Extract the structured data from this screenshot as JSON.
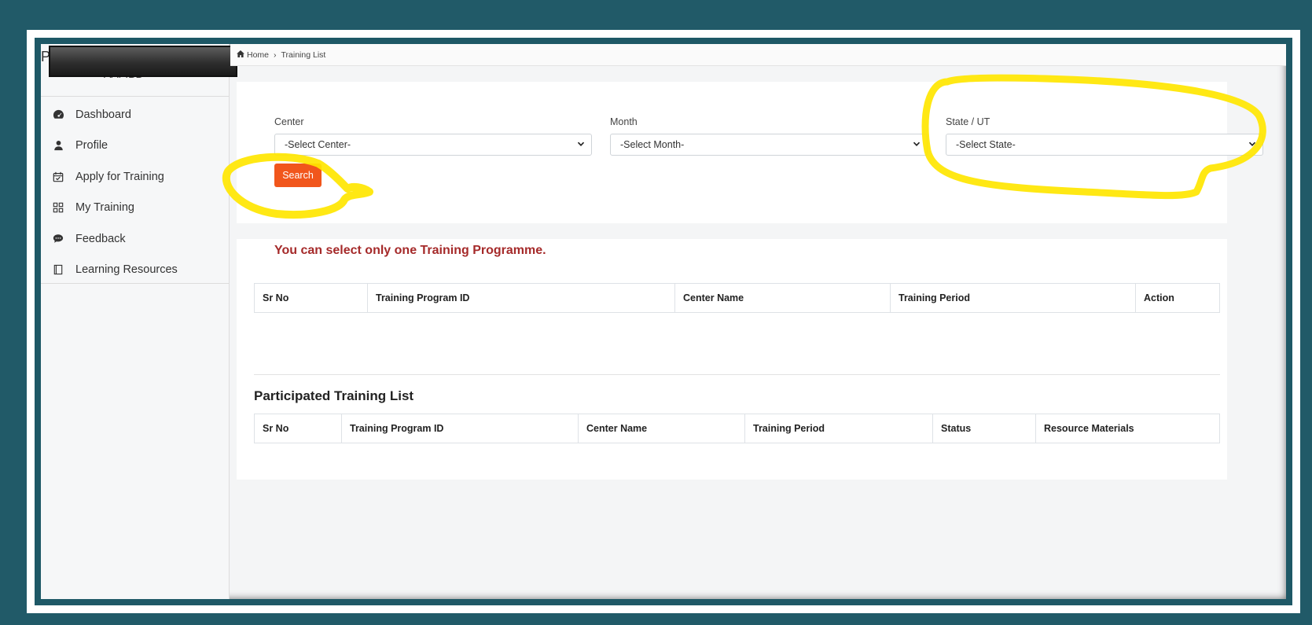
{
  "sidebar": {
    "brand_letter": "P",
    "brand_sub": "AAFIBD",
    "items": [
      {
        "label": "Dashboard",
        "icon": "dashboard-icon"
      },
      {
        "label": "Profile",
        "icon": "user-icon"
      },
      {
        "label": "Apply for Training",
        "icon": "calendar-check-icon"
      },
      {
        "label": "My Training",
        "icon": "grid-icon"
      },
      {
        "label": "Feedback",
        "icon": "comment-icon"
      },
      {
        "label": "Learning Resources",
        "icon": "book-icon"
      }
    ]
  },
  "breadcrumb": {
    "home": "Home",
    "current": "Training List"
  },
  "filters": {
    "center_label": "Center",
    "center_value": "-Select Center-",
    "month_label": "Month",
    "month_value": "-Select Month-",
    "state_label": "State / UT",
    "state_value": "-Select State-",
    "search_label": "Search"
  },
  "training_list": {
    "notice": "You can select only one Training Programme.",
    "columns": [
      "Sr No",
      "Training Program ID",
      "Center Name",
      "Training Period",
      "Action"
    ]
  },
  "participated": {
    "title": "Participated Training List",
    "columns": [
      "Sr No",
      "Training Program ID",
      "Center Name",
      "Training Period",
      "Status",
      "Resource Materials"
    ]
  },
  "colors": {
    "frame": "#215a68",
    "accent": "#f1561c",
    "notice": "#a52a2a",
    "highlight": "#ffe600"
  }
}
